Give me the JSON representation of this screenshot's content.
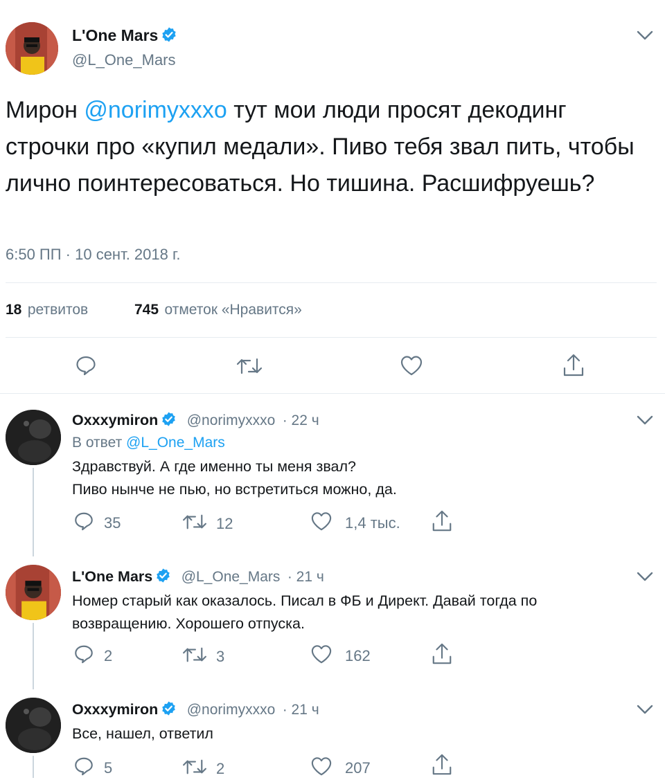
{
  "tweet": {
    "author_name": "L'One Mars",
    "author_handle": "@L_One_Mars",
    "text_start": "Мирон ",
    "mention": "@norimyxxxo",
    "text_rest": " тут мои люди просят декодинг строчки про «купил медали». Пиво тебя звал пить, чтобы лично поинтересоваться. Но тишина. Расшифруешь?",
    "timestamp": "6:50 ПП · 10 сент. 2018 г.",
    "retweets_count": "18",
    "retweets_label": "ретвитов",
    "likes_count": "745",
    "likes_label": "отметок «Нравится»"
  },
  "replies": [
    {
      "author_name": "Oxxxymiron",
      "author_handle": "@norimyxxxo",
      "time": "· 22 ч",
      "reply_to_prefix": "В ответ ",
      "reply_to_handle": "@L_One_Mars",
      "text_line1": "Здравствуй. А где именно ты меня звал?",
      "text_line2": "Пиво нынче не пью, но встретиться можно, да.",
      "replies": "35",
      "retweets": "12",
      "likes": "1,4 тыс."
    },
    {
      "author_name": "L'One Mars",
      "author_handle": "@L_One_Mars",
      "time": "· 21 ч",
      "text_line1": "Номер старый как оказалось. Писал в ФБ и Директ. Давай тогда по",
      "text_line2": "возвращению. Хорошего отпуска.",
      "replies": "2",
      "retweets": "3",
      "likes": "162"
    },
    {
      "author_name": "Oxxxymiron",
      "author_handle": "@norimyxxxo",
      "time": "· 21 ч",
      "text_line1": "Все, нашел, ответил",
      "replies": "5",
      "retweets": "2",
      "likes": "207"
    }
  ],
  "colors": {
    "link": "#1da1f2",
    "secondary_text": "#657786",
    "verified": "#1da1f2",
    "divider": "#e6ecf0"
  },
  "icons": [
    "verified-badge-icon",
    "chevron-down-icon",
    "reply-icon",
    "retweet-icon",
    "like-icon",
    "share-icon"
  ]
}
